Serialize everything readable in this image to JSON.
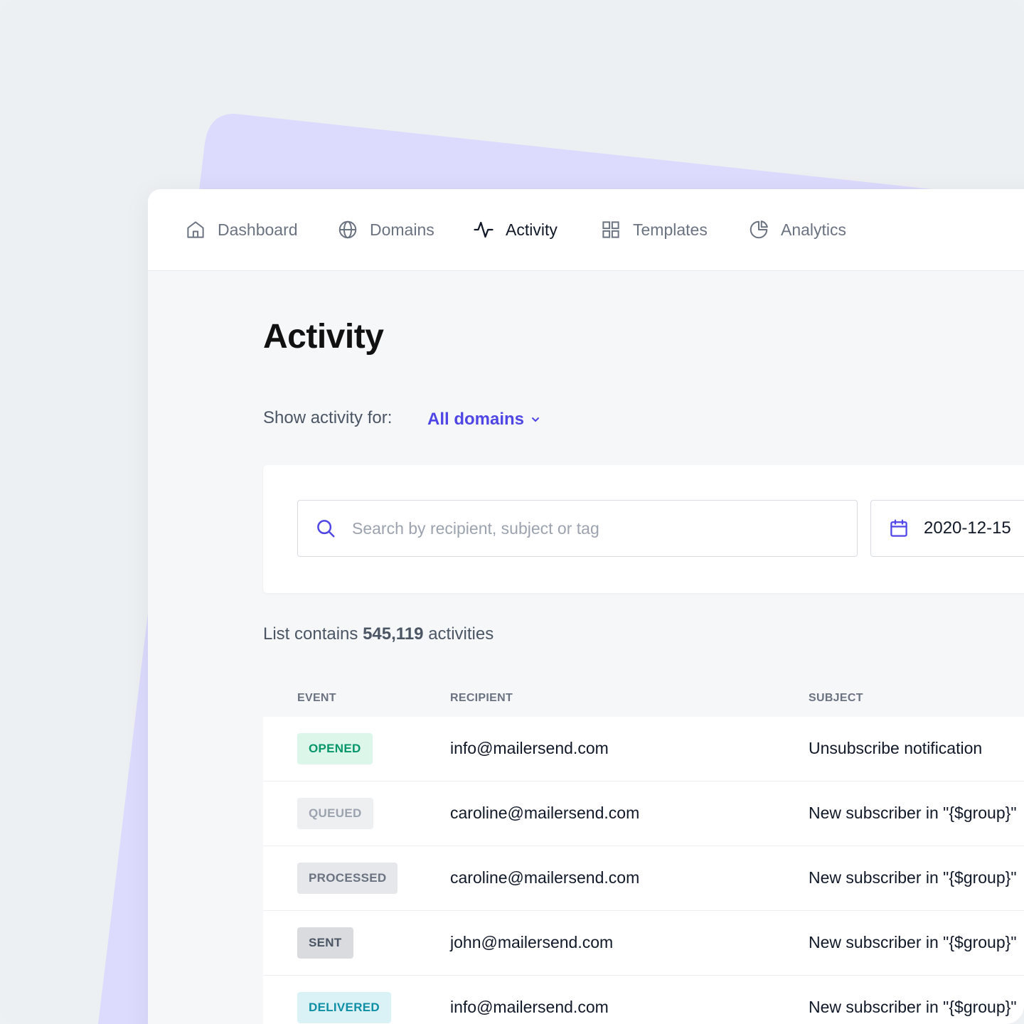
{
  "nav": {
    "items": [
      {
        "label": "Dashboard",
        "icon": "home-icon",
        "active": false
      },
      {
        "label": "Domains",
        "icon": "globe-icon",
        "active": false
      },
      {
        "label": "Activity",
        "icon": "activity-pulse-icon",
        "active": true
      },
      {
        "label": "Templates",
        "icon": "grid-icon",
        "active": false
      },
      {
        "label": "Analytics",
        "icon": "pie-chart-icon",
        "active": false
      }
    ]
  },
  "page": {
    "title": "Activity",
    "filter_label": "Show activity for:",
    "domain_select": "All domains"
  },
  "search": {
    "placeholder": "Search by recipient, subject or tag",
    "date": "2020-12-15"
  },
  "summary": {
    "prefix": "List contains",
    "count": "545,119",
    "suffix": "activities"
  },
  "table": {
    "headers": {
      "event": "EVENT",
      "recipient": "RECIPIENT",
      "subject": "SUBJECT"
    },
    "rows": [
      {
        "event": "OPENED",
        "recipient": "info@mailersend.com",
        "subject": "Unsubscribe notification"
      },
      {
        "event": "QUEUED",
        "recipient": "caroline@mailersend.com",
        "subject": "New subscriber in \"{$group}\""
      },
      {
        "event": "PROCESSED",
        "recipient": "caroline@mailersend.com",
        "subject": "New subscriber in \"{$group}\""
      },
      {
        "event": "SENT",
        "recipient": "john@mailersend.com",
        "subject": "New subscriber in \"{$group}\""
      },
      {
        "event": "DELIVERED",
        "recipient": "info@mailersend.com",
        "subject": "New subscriber in \"{$group}\""
      }
    ]
  },
  "colors": {
    "accent": "#4f46e5",
    "decor_purple": "#dcdafd",
    "badge_opened_bg": "#dcf6ea",
    "badge_opened_fg": "#059669",
    "badge_queued_bg": "#eeeff1",
    "badge_queued_fg": "#9ca3af",
    "badge_processed_bg": "#e5e7eb",
    "badge_processed_fg": "#6b7280",
    "badge_sent_bg": "#d9dbde",
    "badge_sent_fg": "#4b5563",
    "badge_delivered_bg": "#daf1f6",
    "badge_delivered_fg": "#0e8fa6"
  }
}
